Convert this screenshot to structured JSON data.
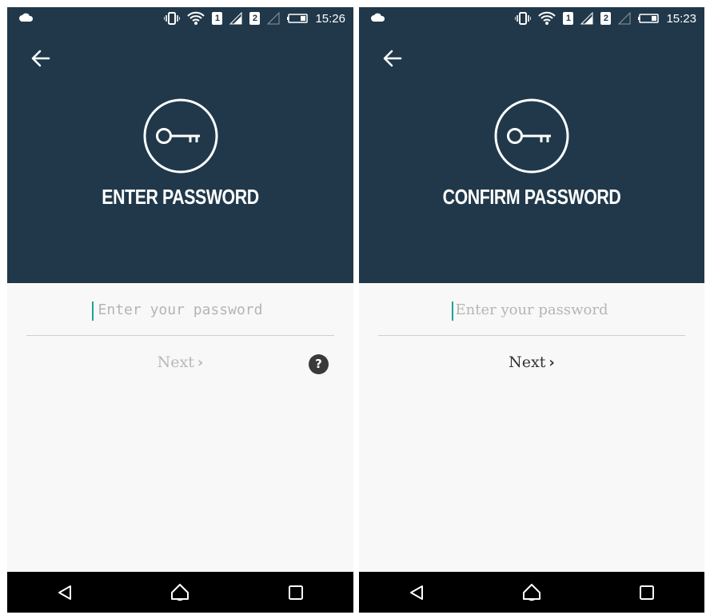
{
  "screens": [
    {
      "status": {
        "time": "15:26",
        "sim1": "1",
        "sim2": "2"
      },
      "title": "ENTER PASSWORD",
      "password": {
        "placeholder": "Enter your password",
        "value": ""
      },
      "next_label": "Next",
      "next_chevron": "›",
      "help_label": "?"
    },
    {
      "status": {
        "time": "15:23",
        "sim1": "1",
        "sim2": "2"
      },
      "title": "CONFIRM PASSWORD",
      "password": {
        "placeholder": "Enter your password",
        "value": ""
      },
      "next_label": "Next",
      "next_chevron": "›"
    }
  ],
  "colors": {
    "header_bg": "#20384a",
    "content_bg": "#f8f8f8",
    "caret": "#1aa39a",
    "navbar_bg": "#000000"
  },
  "icons": [
    "cloud-icon",
    "vibrate-icon",
    "wifi-icon",
    "signal-icon",
    "battery-icon",
    "back-arrow-icon",
    "key-icon",
    "help-icon",
    "nav-back-icon",
    "nav-home-icon",
    "nav-recents-icon"
  ]
}
